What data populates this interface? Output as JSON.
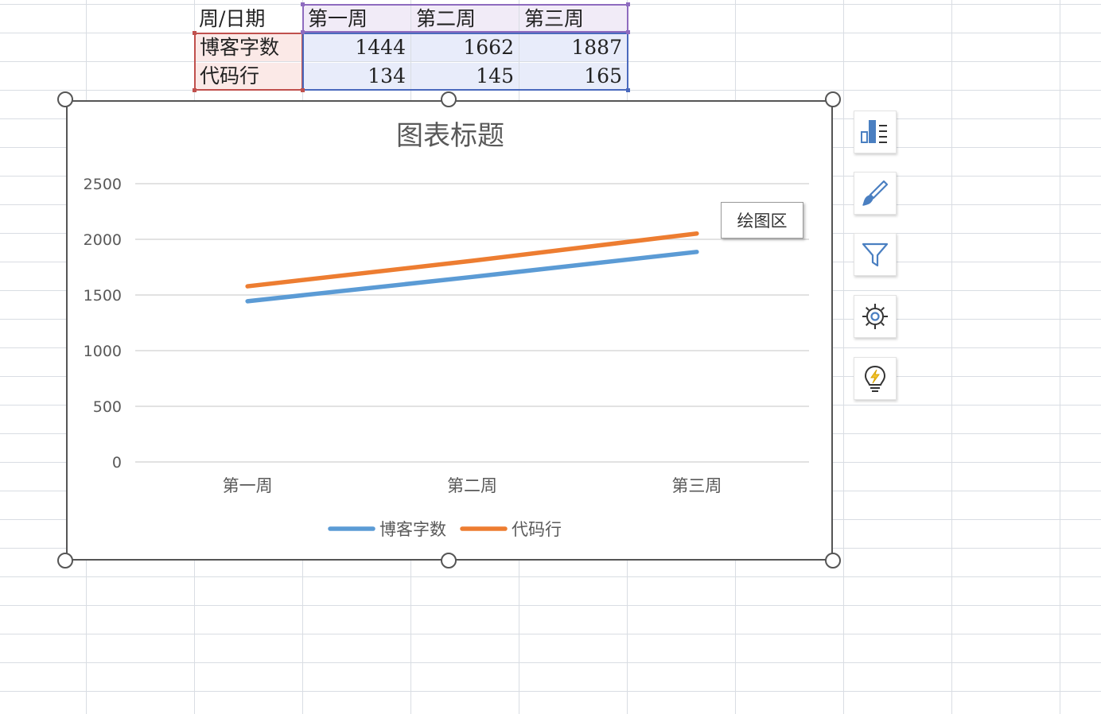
{
  "table": {
    "corner_header": "周/日期",
    "columns": [
      "第一周",
      "第二周",
      "第三周"
    ],
    "rows": [
      {
        "label": "博客字数",
        "values": [
          "1444",
          "1662",
          "1887"
        ]
      },
      {
        "label": "代码行",
        "values": [
          "134",
          "145",
          "165"
        ]
      }
    ]
  },
  "colors": {
    "series1": "#5b9bd5",
    "series2": "#ed7d31",
    "grid": "#d9d9d9",
    "range_purple": "#8e6bbf",
    "range_red": "#c0504d",
    "range_blue": "#4a69bd"
  },
  "chart_data": {
    "type": "line",
    "title": "图表标题",
    "categories": [
      "第一周",
      "第二周",
      "第三周"
    ],
    "series": [
      {
        "name": "博客字数",
        "values": [
          1444,
          1662,
          1887
        ]
      },
      {
        "name": "代码行",
        "values": [
          1578,
          1807,
          2052
        ]
      }
    ],
    "yticks": [
      "0",
      "500",
      "1000",
      "1500",
      "2000",
      "2500"
    ],
    "ylim": [
      0,
      2500
    ],
    "grid": true,
    "legend": "bottom",
    "stacked": true
  },
  "tooltip": "绘图区",
  "side_buttons": [
    "chart-elements-icon",
    "chart-style-brush-icon",
    "chart-filter-icon",
    "chart-settings-gear-icon",
    "chart-ideas-lightbulb-icon"
  ]
}
